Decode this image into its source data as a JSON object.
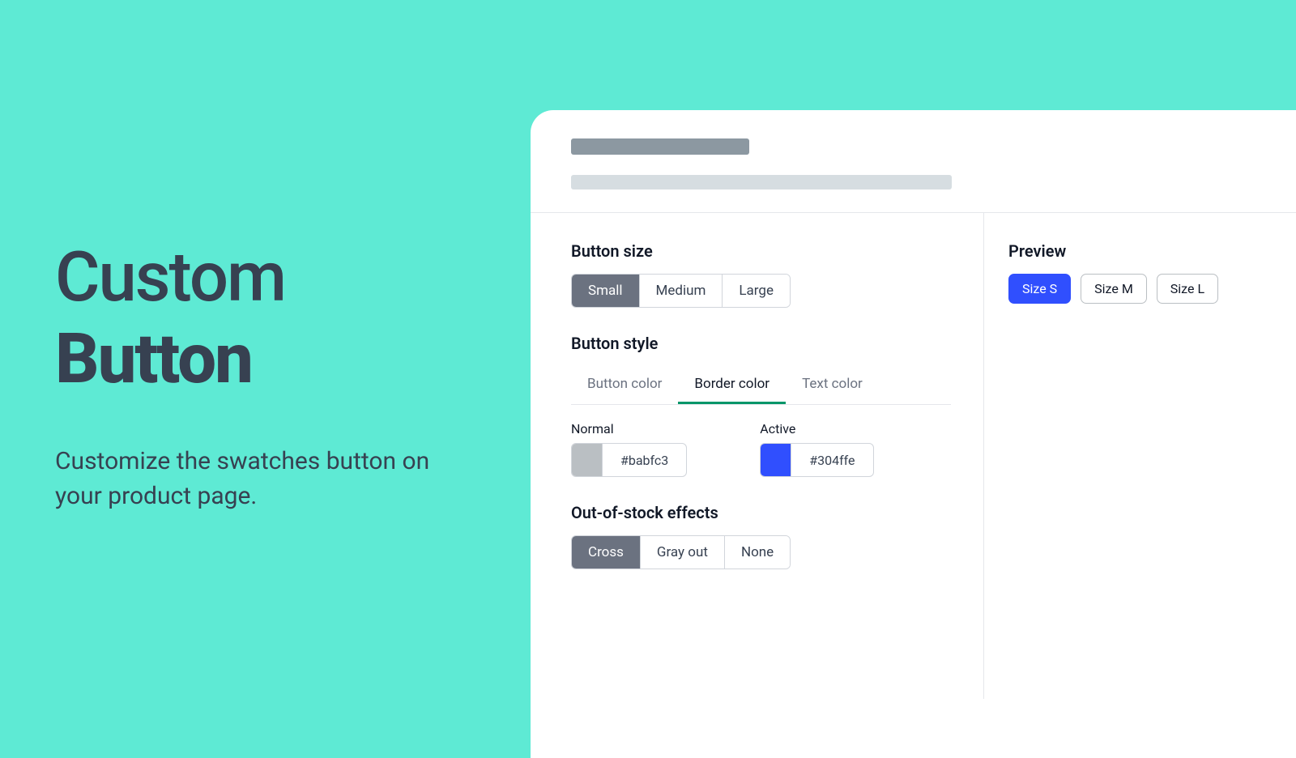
{
  "hero": {
    "title_line1": "Custom",
    "title_line2": "Button",
    "subtitle": "Customize the swatches button on your product page."
  },
  "settings": {
    "button_size": {
      "title": "Button size",
      "options": [
        "Small",
        "Medium",
        "Large"
      ],
      "selected": "Small"
    },
    "button_style": {
      "title": "Button style",
      "tabs": [
        "Button color",
        "Border color",
        "Text color"
      ],
      "active_tab": "Border color",
      "normal": {
        "label": "Normal",
        "value": "#babfc3",
        "color": "#babfc3"
      },
      "active": {
        "label": "Active",
        "value": "#304ffe",
        "color": "#304ffe"
      }
    },
    "out_of_stock": {
      "title": "Out-of-stock effects",
      "options": [
        "Cross",
        "Gray out",
        "None"
      ],
      "selected": "Cross"
    }
  },
  "preview": {
    "title": "Preview",
    "buttons": [
      "Size S",
      "Size M",
      "Size L"
    ],
    "active": "Size S"
  }
}
